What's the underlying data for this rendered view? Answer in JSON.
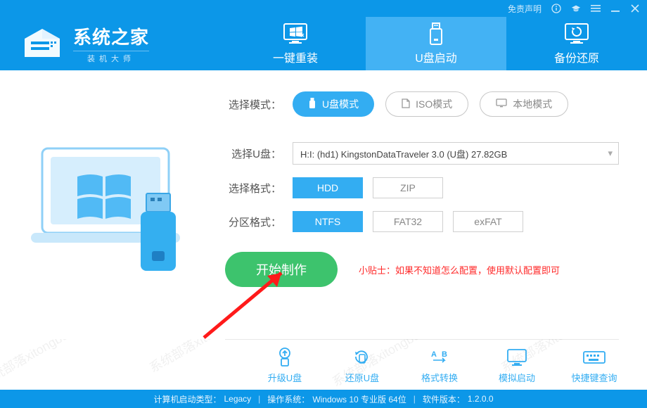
{
  "titlebar": {
    "disclaimer": "免责声明"
  },
  "header": {
    "brand": "系统之家",
    "brand_sub": "装机大师",
    "tabs": [
      {
        "key": "reinstall",
        "label": "一键重装"
      },
      {
        "key": "usb",
        "label": "U盘启动"
      },
      {
        "key": "backup",
        "label": "备份还原"
      }
    ],
    "active_tab": "usb"
  },
  "panel": {
    "mode_label": "选择模式：",
    "modes": [
      {
        "key": "usb",
        "label": "U盘模式",
        "primary": true
      },
      {
        "key": "iso",
        "label": "ISO模式",
        "primary": false
      },
      {
        "key": "local",
        "label": "本地模式",
        "primary": false
      }
    ],
    "usb_label": "选择U盘：",
    "usb_selected": "H:I: (hd1) KingstonDataTraveler 3.0 (U盘) 27.82GB",
    "format_label": "选择格式：",
    "formats": [
      {
        "key": "hdd",
        "label": "HDD",
        "active": true
      },
      {
        "key": "zip",
        "label": "ZIP",
        "active": false
      }
    ],
    "partition_label": "分区格式：",
    "partitions": [
      {
        "key": "ntfs",
        "label": "NTFS",
        "active": true
      },
      {
        "key": "fat32",
        "label": "FAT32",
        "active": false
      },
      {
        "key": "exfat",
        "label": "exFAT",
        "active": false
      }
    ],
    "start_label": "开始制作",
    "tip_prefix": "小贴士：",
    "tip_text": "如果不知道怎么配置，使用默认配置即可"
  },
  "tools": [
    {
      "key": "upgrade",
      "label": "升级U盘"
    },
    {
      "key": "restore",
      "label": "还原U盘"
    },
    {
      "key": "convert",
      "label": "格式转换"
    },
    {
      "key": "simboot",
      "label": "模拟启动"
    },
    {
      "key": "hotkeys",
      "label": "快捷键查询"
    }
  ],
  "status": {
    "boot_type_label": "计算机启动类型：",
    "boot_type": "Legacy",
    "os_label": "操作系统：",
    "os": "Windows 10 专业版 64位",
    "ver_label": "软件版本：",
    "ver": "1.2.0.0"
  },
  "watermark_text": "系统部落xitongbuluo.com"
}
